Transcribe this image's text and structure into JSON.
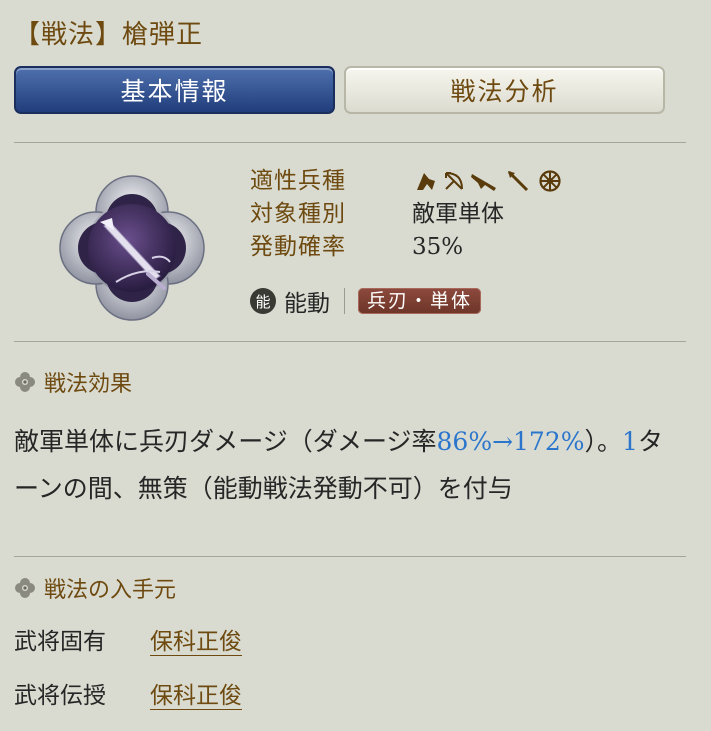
{
  "header": {
    "title": "【戦法】槍弾正"
  },
  "tabs": [
    {
      "label": "基本情報",
      "active": true
    },
    {
      "label": "戦法分析",
      "active": false
    }
  ],
  "info": {
    "troop_label": "適性兵種",
    "troop_icons": [
      "cavalry-icon",
      "archer-icon",
      "musket-icon",
      "spear-icon",
      "siege-icon"
    ],
    "target_label": "対象種別",
    "target_value": "敵軍単体",
    "rate_label": "発動確率",
    "rate_value": "35%",
    "type_badge": "能",
    "type_label": "能動",
    "type_tag": "兵刃・単体"
  },
  "effect": {
    "heading": "戦法効果",
    "p1": "敵軍単体に兵刃ダメージ（ダメージ率",
    "p1_hl": "86%→172%",
    "p2": "）。",
    "p2_hl": "1",
    "p3": "ターンの間、無策（能動戦法発動不可）を付与"
  },
  "source": {
    "heading": "戦法の入手元",
    "rows": [
      {
        "label": "武将固有",
        "value": "保科正俊"
      },
      {
        "label": "武将伝授",
        "value": "保科正俊"
      }
    ]
  },
  "colors": {
    "background": "#d9dbd0",
    "label": "#6e4a10",
    "accent_blue": "#2b76cc",
    "active_tab": "#213d7c",
    "tag": "#7a3d31"
  }
}
